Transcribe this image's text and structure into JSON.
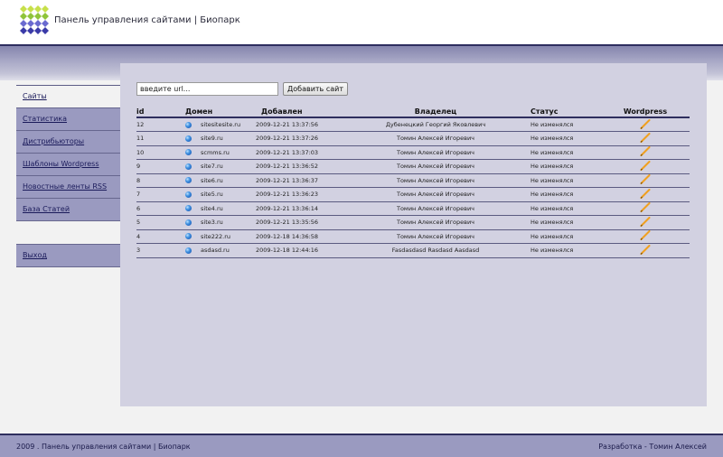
{
  "header": {
    "title": "Панель управления сайтами | Биопарк",
    "logo_icon": "diamond-grid-logo"
  },
  "sidebar": {
    "items": [
      {
        "label": "Сайты",
        "active": true
      },
      {
        "label": "Статистика"
      },
      {
        "label": "Дистрибьюторы"
      },
      {
        "label": "Шаблоны Wordpress"
      },
      {
        "label": "Новостные ленты RSS"
      },
      {
        "label": "База Статей"
      }
    ],
    "logout_label": "Выход"
  },
  "form": {
    "url_value": "введите url...",
    "add_button_label": "Добавить сайт"
  },
  "table": {
    "headers": {
      "id": "id",
      "domain": "Домен",
      "added": "Добавлен",
      "owner": "Владелец",
      "status": "Статус",
      "wordpress": "Wordpress"
    },
    "rows": [
      {
        "id": "12",
        "domain": "sitesitesite.ru",
        "added": "2009-12-21 13:37:56",
        "owner": "Дубенецкий Георгий Яковлевич",
        "status": "Не изменялся"
      },
      {
        "id": "11",
        "domain": "site9.ru",
        "added": "2009-12-21 13:37:26",
        "owner": "Томин Алексей Игоревич",
        "status": "Не изменялся"
      },
      {
        "id": "10",
        "domain": "scmms.ru",
        "added": "2009-12-21 13:37:03",
        "owner": "Томин Алексей Игоревич",
        "status": "Не изменялся"
      },
      {
        "id": "9",
        "domain": "site7.ru",
        "added": "2009-12-21 13:36:52",
        "owner": "Томин Алексей Игоревич",
        "status": "Не изменялся"
      },
      {
        "id": "8",
        "domain": "site6.ru",
        "added": "2009-12-21 13:36:37",
        "owner": "Томин Алексей Игоревич",
        "status": "Не изменялся"
      },
      {
        "id": "7",
        "domain": "site5.ru",
        "added": "2009-12-21 13:36:23",
        "owner": "Томин Алексей Игоревич",
        "status": "Не изменялся"
      },
      {
        "id": "6",
        "domain": "site4.ru",
        "added": "2009-12-21 13:36:14",
        "owner": "Томин Алексей Игоревич",
        "status": "Не изменялся"
      },
      {
        "id": "5",
        "domain": "site3.ru",
        "added": "2009-12-21 13:35:56",
        "owner": "Томин Алексей Игоревич",
        "status": "Не изменялся"
      },
      {
        "id": "4",
        "domain": "site222.ru",
        "added": "2009-12-18 14:36:58",
        "owner": "Томин Алексей Игоревич",
        "status": "Не изменялся"
      },
      {
        "id": "3",
        "domain": "asdasd.ru",
        "added": "2009-12-18 12:44:16",
        "owner": "Fasdasdasd Rasdasd Aasdasd",
        "status": "Не изменялся"
      }
    ],
    "row_icons": {
      "domain": "globe-icon",
      "wordpress": "pencil-edit-icon"
    }
  },
  "footer": {
    "left": "2009 . Панель управления сайтами | Биопарк",
    "right": "Разработка - Томин Алексей"
  },
  "colors": {
    "accent_dark": "#2e2e5e",
    "nav_bg": "#9a9ac0",
    "content_bg": "#d2d1e1",
    "pencil": "#f0a020"
  }
}
